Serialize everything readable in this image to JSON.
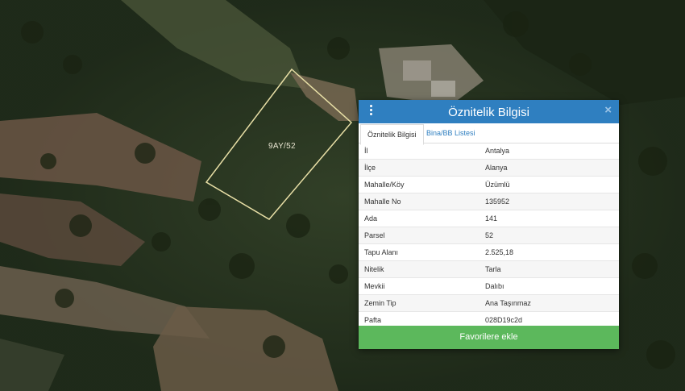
{
  "map": {
    "parcel_label": "9AY/52"
  },
  "panel": {
    "title": "Öznitelik Bilgisi",
    "close_symbol": "×",
    "menu_icon": "vertical-dots-icon",
    "tabs": [
      {
        "label": "Öznitelik Bilgisi",
        "active": true
      },
      {
        "label": "Bina/BB Listesi",
        "active": false
      }
    ],
    "rows": [
      {
        "key": "İl",
        "value": "Antalya"
      },
      {
        "key": "İlçe",
        "value": "Alanya"
      },
      {
        "key": "Mahalle/Köy",
        "value": "Üzümlü"
      },
      {
        "key": "Mahalle No",
        "value": "135952"
      },
      {
        "key": "Ada",
        "value": "141"
      },
      {
        "key": "Parsel",
        "value": "52"
      },
      {
        "key": "Tapu Alanı",
        "value": "2.525,18"
      },
      {
        "key": "Nitelik",
        "value": "Tarla"
      },
      {
        "key": "Mevkii",
        "value": "Dalıbı"
      },
      {
        "key": "Zemin Tip",
        "value": "Ana Taşınmaz"
      },
      {
        "key": "Pafta",
        "value": "028D19c2d"
      }
    ],
    "favorite_button": "Favorilere ekle"
  },
  "colors": {
    "header": "#2f7fc0",
    "button": "#5cb85c",
    "parcel_outline": "#e8dfa6"
  }
}
